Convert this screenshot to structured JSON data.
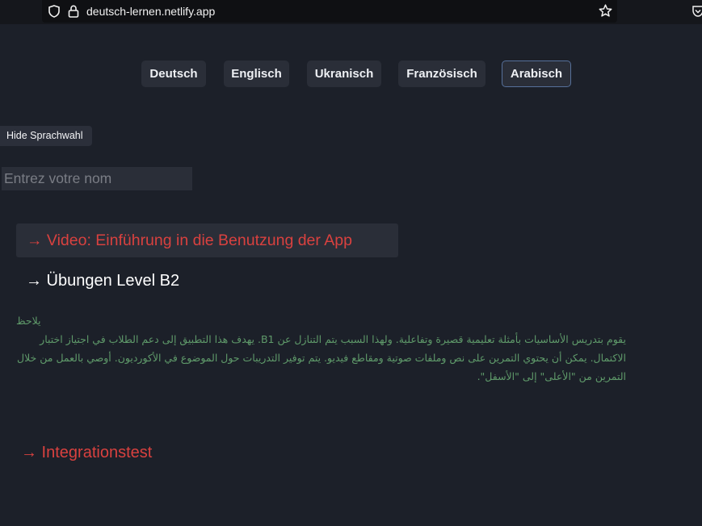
{
  "browser": {
    "url": "deutsch-lernen.netlify.app",
    "icons": [
      "shield-icon",
      "lock-icon",
      "star-icon",
      "pocket-icon"
    ]
  },
  "languages": [
    {
      "label": "Deutsch",
      "active": false
    },
    {
      "label": "Englisch",
      "active": false
    },
    {
      "label": "Ukranisch",
      "active": false
    },
    {
      "label": "Französisch",
      "active": false
    },
    {
      "label": "Arabisch",
      "active": true
    }
  ],
  "controls": {
    "hide_label": "Hide Sprachwahl",
    "name_placeholder": "Entrez votre nom"
  },
  "links": {
    "video": "→ Video: Einführung in die Benutzung der App",
    "exercises": "→ Übungen Level B2",
    "integration": "→ Integrationstest"
  },
  "note": {
    "title": "يلاحظ",
    "body": "يقوم بتدريس الأساسيات بأمثلة تعليمية قصيرة وتفاعلية. ولهذا السبب يتم التنازل عن B1. يهدف هذا التطبيق إلى دعم الطلاب في اجتياز اختبار الاكتمال. يمكن أن يحتوي التمرين على نص وملفات صوتية ومقاطع فيديو. يتم توفير التدريبات حول الموضوع في الأكورديون. أوصي بالعمل من خلال التمرين من \"الأعلى\" إلى \"الأسفل\"."
  },
  "colors": {
    "background": "#1c2029",
    "button_bg": "#2a2e38",
    "active_border": "#56709a",
    "link_red": "#d9413f",
    "note_green": "#5f9a6a"
  }
}
